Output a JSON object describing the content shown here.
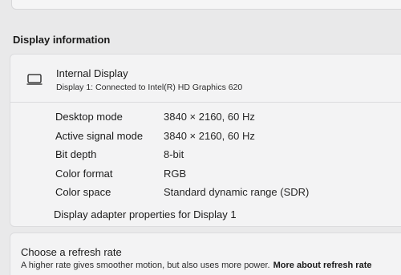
{
  "section": {
    "title": "Display information"
  },
  "display": {
    "icon": "monitor-icon",
    "name": "Internal Display",
    "subtitle": "Display 1: Connected to Intel(R) HD Graphics 620"
  },
  "properties": [
    {
      "label": "Desktop mode",
      "value": "3840 × 2160, 60 Hz"
    },
    {
      "label": "Active signal mode",
      "value": "3840 × 2160, 60 Hz"
    },
    {
      "label": "Bit depth",
      "value": "8-bit"
    },
    {
      "label": "Color format",
      "value": "RGB"
    },
    {
      "label": "Color space",
      "value": "Standard dynamic range (SDR)"
    }
  ],
  "adapter_link": "Display adapter properties for Display 1",
  "refresh": {
    "title": "Choose a refresh rate",
    "description": "A higher rate gives smoother motion, but also uses more power.",
    "link": "More about refresh rate"
  }
}
